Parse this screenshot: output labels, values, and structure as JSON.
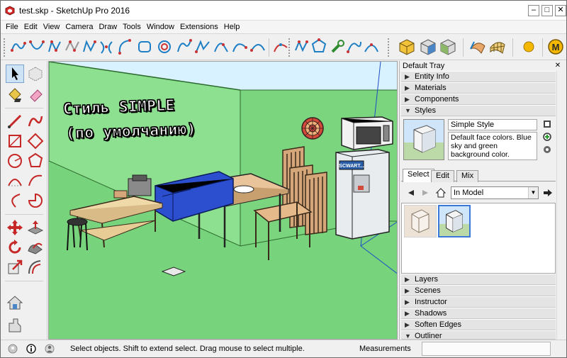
{
  "window": {
    "title": "test.skp - SketchUp Pro 2016",
    "controls": {
      "minimize": "–",
      "maximize": "□",
      "close": "✕"
    }
  },
  "menu": [
    "File",
    "Edit",
    "View",
    "Camera",
    "Draw",
    "Tools",
    "Window",
    "Extensions",
    "Help"
  ],
  "toolbar": {
    "icons": [
      "spline-icon",
      "catenary-icon",
      "bezier-icon",
      "polyline-icon",
      "curve-icon",
      "arc-icon",
      "rounded-rect-icon",
      "spiral-icon",
      "freehand-icon",
      "zigzag-icon",
      "segment-arc-icon",
      "arc-curve-icon",
      "dividing-icon",
      "polygon-icon",
      "wrench-icon",
      "edit-curve-icon",
      "bezier-edit-icon",
      "cube-iso-icon",
      "cube-front-icon",
      "cube-side-icon",
      "surface-icon",
      "mesh-icon",
      "sun-icon",
      "extension-m-icon"
    ]
  },
  "palette": {
    "tools": [
      "select-icon",
      "make-component-icon",
      "paint-bucket-icon",
      "eraser-icon",
      "line-icon",
      "freehand-icon",
      "rectangle-icon",
      "rotated-rectangle-icon",
      "circle-icon",
      "polygon-icon",
      "arc-icon",
      "two-point-arc-icon",
      "three-point-arc-icon",
      "pie-icon",
      "move-icon",
      "push-pull-icon",
      "rotate-icon",
      "follow-me-icon",
      "scale-icon",
      "offset-icon",
      "warehouse-icon",
      "extension-warehouse-icon"
    ]
  },
  "viewport": {
    "heading_line1": "Стиль SIMPLE",
    "heading_line2": "(по умолчанию)",
    "sky_color": "#d9f2ff",
    "ground_color": "#78d47c",
    "wall_color": "#8ce08f",
    "microwave_label": "SCWART..."
  },
  "tray": {
    "title": "Default Tray",
    "panels_top": [
      {
        "label": "Entity Info",
        "expanded": false
      },
      {
        "label": "Materials",
        "expanded": false
      },
      {
        "label": "Components",
        "expanded": false
      },
      {
        "label": "Styles",
        "expanded": true
      }
    ],
    "styles": {
      "name": "Simple Style",
      "description": "Default face colors. Blue sky and green background color.",
      "tabs": [
        "Select",
        "Edit",
        "Mix"
      ],
      "active_tab": "Select",
      "collection": "In Model"
    },
    "panels_bottom": [
      {
        "label": "Layers"
      },
      {
        "label": "Scenes"
      },
      {
        "label": "Instructor"
      },
      {
        "label": "Shadows"
      },
      {
        "label": "Soften Edges"
      },
      {
        "label": "Outliner"
      }
    ],
    "close_glyph": "x"
  },
  "status": {
    "message": "Select objects. Shift to extend select. Drag mouse to select multiple.",
    "measurements_label": "Measurements",
    "measurements_value": ""
  }
}
